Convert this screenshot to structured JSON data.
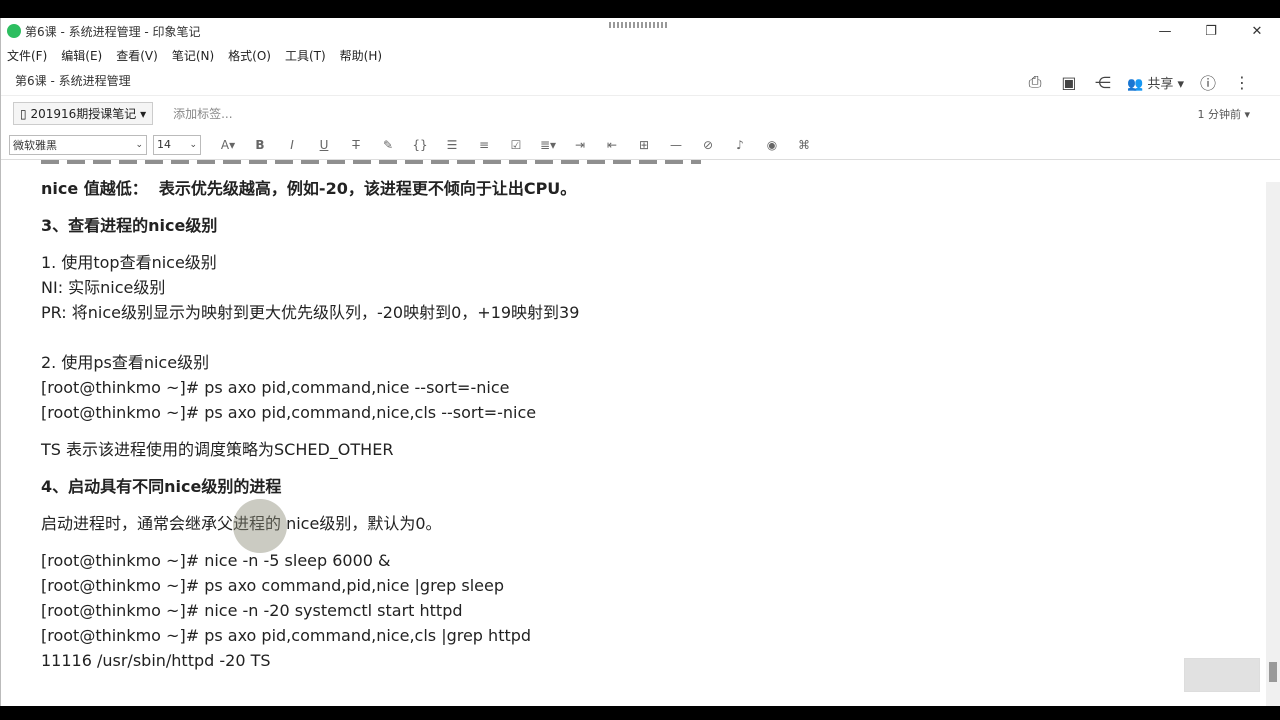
{
  "window": {
    "title": "第6课 - 系统进程管理 - 印象笔记",
    "minimize": "—",
    "maximize": "❐",
    "close": "✕"
  },
  "menu": [
    "文件(F)",
    "编辑(E)",
    "查看(V)",
    "笔记(N)",
    "格式(O)",
    "工具(T)",
    "帮助(H)"
  ],
  "note": {
    "title": "第6课 - 系统进程管理",
    "share_label": "共享",
    "notebook": "201916期授课笔记",
    "tag_placeholder": "添加标签...",
    "modified": "1 分钟前"
  },
  "toolbar": {
    "font": "微软雅黑",
    "size": "14"
  },
  "lines": [
    "nice 值越低：  表示优先级越高，例如-20，该进程更不倾向于让出CPU。",
    "3、查看进程的nice级别",
    "1. 使用top查看nice级别",
    "NI: 实际nice级别",
    "PR: 将nice级别显示为映射到更大优先级队列，-20映射到0，+19映射到39",
    "2. 使用ps查看nice级别",
    "[root@thinkmo ~]# ps axo pid,command,nice --sort=-nice",
    "[root@thinkmo ~]# ps axo pid,command,nice,cls --sort=-nice",
    "TS 表示该进程使用的调度策略为SCHED_OTHER",
    "4、启动具有不同nice级别的进程",
    "启动进程时，通常会继承父进程的 nice级别，默认为0。",
    "[root@thinkmo ~]# nice -n -5 sleep 6000 &",
    "[root@thinkmo ~]# ps axo command,pid,nice |grep sleep",
    "[root@thinkmo ~]# nice -n -20 systemctl start httpd",
    "[root@thinkmo ~]# ps axo pid,command,nice,cls |grep httpd",
    "11116 /usr/sbin/httpd -20 TS"
  ]
}
